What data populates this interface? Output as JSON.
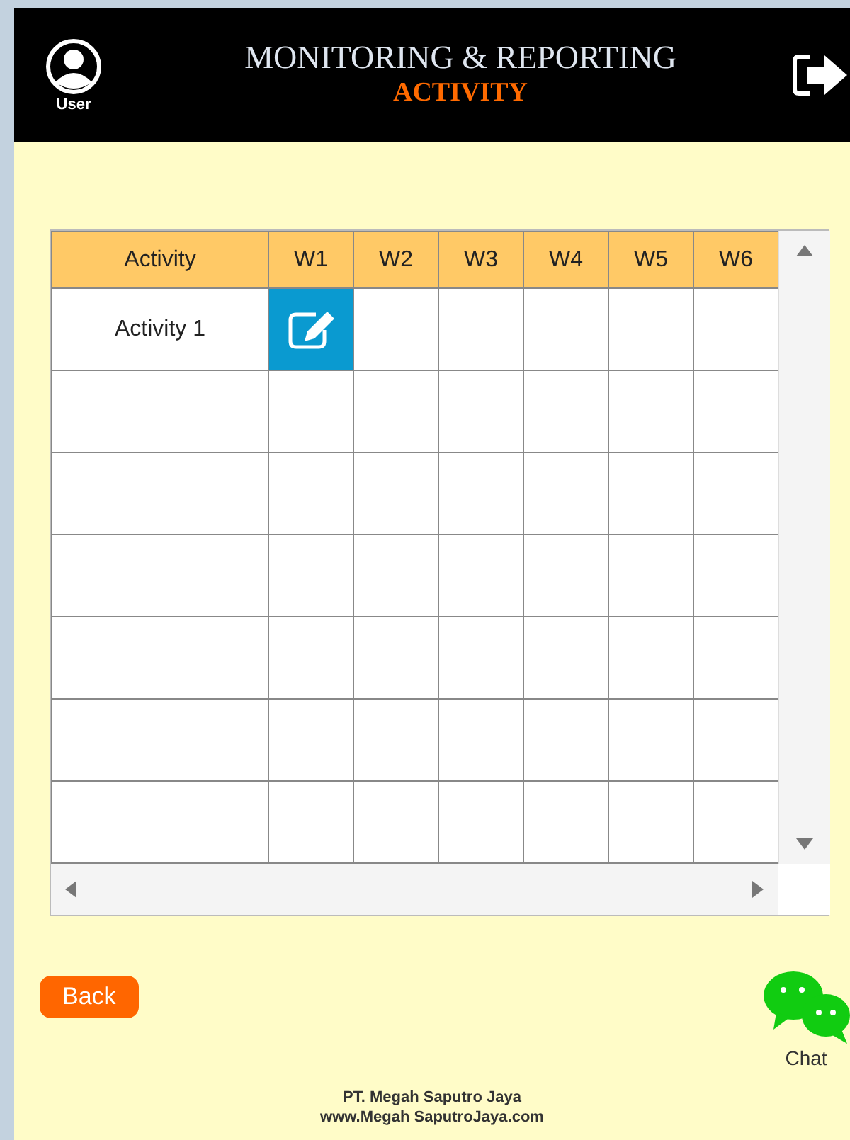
{
  "header": {
    "user_label": "User",
    "title": "MONITORING & REPORTING",
    "subtitle": "ACTIVITY"
  },
  "table": {
    "columns": [
      "Activity",
      "W1",
      "W2",
      "W3",
      "W4",
      "W5",
      "W6"
    ],
    "rows": [
      {
        "kind": "data",
        "activity": "Activity 1",
        "cells": [
          {
            "kind": "edit"
          },
          {
            "kind": "empty"
          },
          {
            "kind": "empty"
          },
          {
            "kind": "empty"
          },
          {
            "kind": "empty"
          },
          {
            "kind": "empty"
          }
        ]
      },
      {
        "kind": "blank"
      },
      {
        "kind": "blank"
      },
      {
        "kind": "blank"
      },
      {
        "kind": "blank"
      },
      {
        "kind": "blank"
      },
      {
        "kind": "blank"
      }
    ]
  },
  "back_button": "Back",
  "chat_label": "Chat",
  "footer": [
    "PT. Megah  Saputro Jaya",
    "www.Megah SaputroJaya.com"
  ]
}
